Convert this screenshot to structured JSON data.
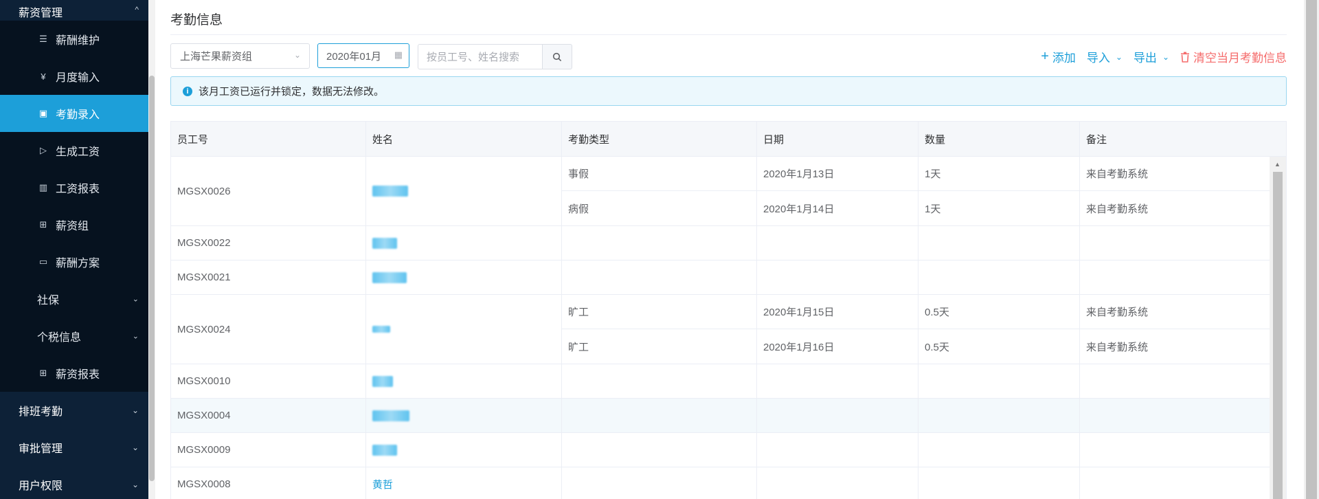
{
  "sidebar": {
    "top_group": "薪资管理",
    "items": [
      {
        "label": "薪酬维护",
        "icon": "list-icon",
        "glyph": "☰"
      },
      {
        "label": "月度输入",
        "icon": "yen-icon",
        "glyph": "¥"
      },
      {
        "label": "考勤录入",
        "icon": "calendar-icon",
        "glyph": "▣",
        "active": true
      },
      {
        "label": "生成工资",
        "icon": "play-icon",
        "glyph": "▷"
      },
      {
        "label": "工资报表",
        "icon": "bar-chart-icon",
        "glyph": "▥"
      },
      {
        "label": "薪资组",
        "icon": "grid-icon",
        "glyph": "⊞"
      },
      {
        "label": "薪酬方案",
        "icon": "card-icon",
        "glyph": "▭"
      }
    ],
    "sub_groups": [
      {
        "label": "社保"
      },
      {
        "label": "个税信息"
      }
    ],
    "report_item": {
      "label": "薪资报表",
      "icon": "grid-icon",
      "glyph": "⊞"
    },
    "groups": [
      {
        "label": "排班考勤"
      },
      {
        "label": "审批管理"
      },
      {
        "label": "用户权限"
      }
    ]
  },
  "page": {
    "title": "考勤信息"
  },
  "filters": {
    "group_select": "上海芒果薪资组",
    "month": "2020年01月",
    "search_placeholder": "按员工号、姓名搜索"
  },
  "actions": {
    "add": "添加",
    "import": "导入",
    "export": "导出",
    "clear": "清空当月考勤信息"
  },
  "alert": {
    "text": "该月工资已运行并锁定，数据无法修改。"
  },
  "table": {
    "columns": [
      "员工号",
      "姓名",
      "考勤类型",
      "日期",
      "数量",
      "备注"
    ],
    "rows": [
      {
        "id": "MGSX0026",
        "records": [
          {
            "type": "事假",
            "date": "2020年1月13日",
            "qty": "1天",
            "note": "来自考勤系统"
          },
          {
            "type": "病假",
            "date": "2020年1月14日",
            "qty": "1天",
            "note": "来自考勤系统"
          }
        ]
      },
      {
        "id": "MGSX0022",
        "records": []
      },
      {
        "id": "MGSX0021",
        "records": []
      },
      {
        "id": "MGSX0024",
        "records": [
          {
            "type": "旷工",
            "date": "2020年1月15日",
            "qty": "0.5天",
            "note": "来自考勤系统"
          },
          {
            "type": "旷工",
            "date": "2020年1月16日",
            "qty": "0.5天",
            "note": "来自考勤系统"
          }
        ]
      },
      {
        "id": "MGSX0010",
        "records": []
      },
      {
        "id": "MGSX0004",
        "records": []
      },
      {
        "id": "MGSX0009",
        "records": []
      },
      {
        "id": "MGSX0008",
        "name": "黄哲",
        "records": []
      }
    ]
  },
  "colors": {
    "accent": "#1d9fd9",
    "danger": "#f56c6c",
    "sidebar_bg": "#0d2137"
  }
}
